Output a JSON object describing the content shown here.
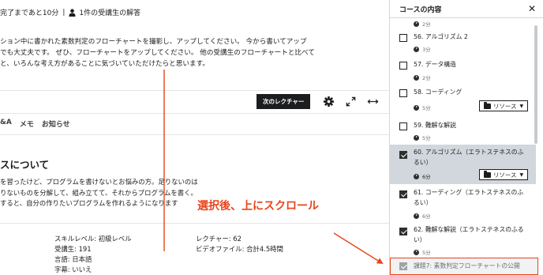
{
  "progress": {
    "remaining": "完了まであと10分",
    "separator": "|",
    "answers": "1件の受講生の解答"
  },
  "description": {
    "lines": [
      "ション中に書かれた素数判定のフローチャートを撮影し、アップしてください。 今から書いてアップ",
      "でも大丈夫です。 ぜひ、フローチャートをアップしてください。 他の受講生のフローチャートと比べて",
      "と、いろんな考え方があることに気づいていただけたらと思います。"
    ]
  },
  "toolbar": {
    "next_lecture": "次のレクチャー",
    "icons": [
      "gear-icon",
      "expand-icon",
      "width-toggle-icon"
    ]
  },
  "tabs": [
    "&A",
    "メモ",
    "お知らせ"
  ],
  "about": {
    "title": "スについて",
    "lines": [
      "を習ったけど、プログラムを書けないとお悩みの方。足りないのは",
      "りないものを分解して、組み立てて、それからプログラムを書く。",
      "すると、自分の作りたいプログラムを作れるようになります"
    ]
  },
  "stats": {
    "left": [
      "スキルレベル: 初級レベル",
      "受講生: 191",
      "言語: 日本語",
      "字幕: いいえ"
    ],
    "right": [
      "レクチャー: 62",
      "ビデオファイル: 合計4.5時間"
    ]
  },
  "annotation": {
    "text": "選択後、上にスクロール",
    "color": "#e8441b"
  },
  "sidebar": {
    "title": "コースの内容",
    "close_icon": "close-icon",
    "top_partial_duration": "2分",
    "resource_label": "リソース",
    "items": [
      {
        "title": "56. アルゴリズム 2",
        "duration": "3分",
        "checked": false,
        "active": false,
        "resources": false
      },
      {
        "title": "57. データ構造",
        "duration": "2分",
        "checked": false,
        "active": false,
        "resources": false
      },
      {
        "title": "58. コーディング",
        "duration": "5分",
        "checked": false,
        "active": false,
        "resources": true
      },
      {
        "title": "59. 難解な解説",
        "duration": "5分",
        "checked": false,
        "active": false,
        "resources": false
      },
      {
        "title": "60. アルゴリズム（エラトステネスのふ",
        "title2": "るい）",
        "duration": "6分",
        "checked": true,
        "active": true,
        "resources": true
      },
      {
        "title": "61. コーディング（エラトステネスのふ",
        "title2": "るい）",
        "duration": "6分",
        "checked": true,
        "active": false,
        "resources": false
      },
      {
        "title": "62. 難解な解説（エラトステネスのふる",
        "title2": "い）",
        "duration": "5分",
        "checked": true,
        "active": false,
        "resources": false
      }
    ],
    "assignment": {
      "title": "課題7: 素数判定フローチャートの公開",
      "checked": true
    }
  }
}
